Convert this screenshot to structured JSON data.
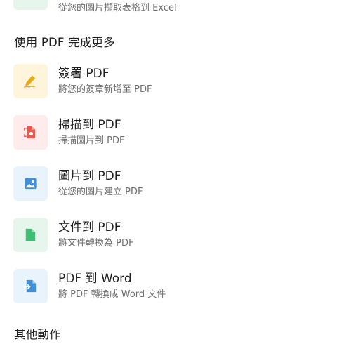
{
  "top_item": {
    "subtitle": "從您的圖片擷取表格到 Excel"
  },
  "sections": {
    "more_with_pdf": "使用 PDF 完成更多",
    "other_actions": "其他動作"
  },
  "tools": [
    {
      "title": "簽署 PDF",
      "subtitle": "將您的簽章新增至 PDF",
      "icon": "sign-pen-icon",
      "tile_color": "#fff4dc",
      "icon_color": "#e9a913"
    },
    {
      "title": "掃描到 PDF",
      "subtitle": "掃描圖片到 PDF",
      "icon": "scan-document-icon",
      "tile_color": "#fdeceb",
      "icon_color": "#e85a4a"
    },
    {
      "title": "圖片到 PDF",
      "subtitle": "從您的圖片建立 PDF",
      "icon": "image-icon",
      "tile_color": "#e9f3fc",
      "icon_color": "#3f8fd9"
    },
    {
      "title": "文件到 PDF",
      "subtitle": "將文件轉換為 PDF",
      "icon": "document-icon",
      "tile_color": "#e6f6ec",
      "icon_color": "#3fbf73"
    },
    {
      "title": "PDF 到 Word",
      "subtitle": "將 PDF 轉換成 Word 文件",
      "icon": "word-convert-icon",
      "tile_color": "#e9f3fc",
      "icon_color": "#3f8fd9"
    }
  ]
}
